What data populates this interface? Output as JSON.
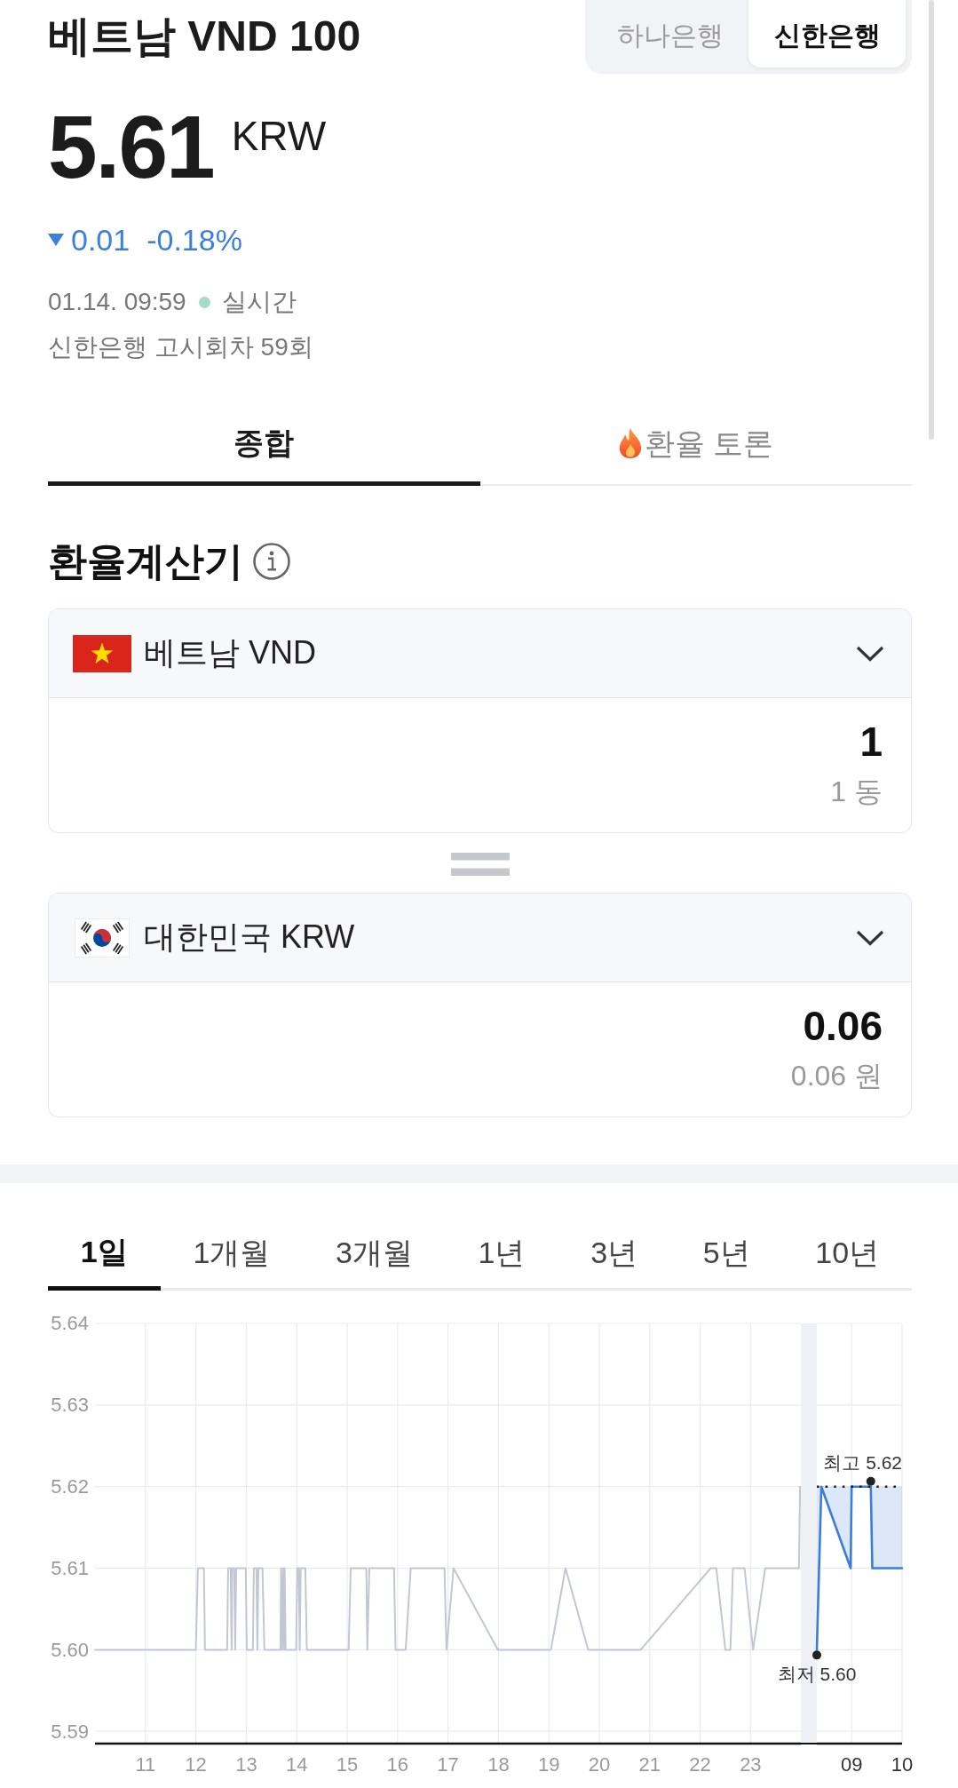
{
  "header": {
    "title": "베트남 VND 100",
    "banks": [
      {
        "label": "하나은행",
        "selected": false
      },
      {
        "label": "신한은행",
        "selected": true
      }
    ]
  },
  "quote": {
    "price": "5.61",
    "currency": "KRW",
    "change": {
      "falling": true,
      "amount": "0.01",
      "percent": "-0.18%"
    },
    "timestamp": "01.14. 09:59",
    "live": "실시간",
    "notice": "신한은행 고시회차 59회"
  },
  "tabs": [
    {
      "label": "종합",
      "selected": true,
      "kind": "plain"
    },
    {
      "label": "환율 토론",
      "selected": false,
      "kind": "fire"
    }
  ],
  "calculator": {
    "title": "환율계산기",
    "currencies": [
      {
        "kind": "vn",
        "name": "베트남 VND",
        "value": "1",
        "reading": "1 동"
      },
      {
        "kind": "kr",
        "name": "대한민국 KRW",
        "value": "0.06",
        "reading": "0.06 원"
      }
    ]
  },
  "chart": {
    "periods": [
      {
        "label": "1일",
        "selected": true
      },
      {
        "label": "1개월",
        "selected": false
      },
      {
        "label": "3개월",
        "selected": false
      },
      {
        "label": "1년",
        "selected": false
      },
      {
        "label": "3년",
        "selected": false
      },
      {
        "label": "5년",
        "selected": false
      },
      {
        "label": "10년",
        "selected": false
      }
    ],
    "sessions": [
      {
        "chart_data": {
          "type": "line",
          "grid": true,
          "x": [
            10,
            12.0,
            12.04,
            12.16,
            12.18,
            12.62,
            12.64,
            12.69,
            12.71,
            12.72,
            12.76,
            12.78,
            12.8,
            12.99,
            13.01,
            13.13,
            13.15,
            13.2,
            13.22,
            13.24,
            13.32,
            13.36,
            13.68,
            13.69,
            13.71,
            13.73,
            13.75,
            13.76,
            13.78,
            13.99,
            14.01,
            14.04,
            14.06,
            14.08,
            14.17,
            14.2,
            15.03,
            15.07,
            15.38,
            15.4,
            15.44,
            15.93,
            15.96,
            16.16,
            16.26,
            16.93,
            16.97,
            17.11,
            17.99,
            19.04,
            19.33,
            19.78,
            20.82,
            22.21,
            22.32,
            22.5,
            22.6,
            22.65,
            22.88,
            23.05,
            23.29,
            23.96,
            23.98
          ],
          "series": [
            {
              "color": "#c3c6d3",
              "values": [
                5.6,
                5.6,
                5.61,
                5.61,
                5.6,
                5.6,
                5.61,
                5.61,
                5.6,
                5.61,
                5.61,
                5.6,
                5.61,
                5.61,
                5.6,
                5.6,
                5.61,
                5.61,
                5.6,
                5.61,
                5.61,
                5.6,
                5.6,
                5.61,
                5.6,
                5.61,
                5.6,
                5.61,
                5.6,
                5.6,
                5.61,
                5.61,
                5.6,
                5.61,
                5.61,
                5.6,
                5.6,
                5.61,
                5.61,
                5.6,
                5.61,
                5.61,
                5.6,
                5.6,
                5.61,
                5.61,
                5.6,
                5.61,
                5.6,
                5.6,
                5.61,
                5.6,
                5.6,
                5.61,
                5.61,
                5.6,
                5.6,
                5.61,
                5.61,
                5.6,
                5.61,
                5.61,
                5.62
              ]
            }
          ],
          "xlim": [
            10,
            24
          ],
          "ylim": [
            5.5885,
            5.64
          ],
          "xticks": [
            11,
            12,
            13,
            14,
            15,
            16,
            17,
            18,
            19,
            20,
            21,
            22,
            23
          ],
          "yticks": [
            5.59,
            {
              "value": 5.6,
              "label": "5.60"
            },
            5.61,
            5.62,
            5.63,
            5.64
          ]
        }
      },
      {
        "chart_data": {
          "type": "line",
          "grid": true,
          "x": [
            8.31,
            8.4,
            8.98,
            9.0,
            9.38,
            9.41,
            10.0
          ],
          "series": [
            {
              "color": "#3b7dd8",
              "values": [
                5.6,
                5.62,
                5.61,
                5.62,
                5.62,
                5.61,
                5.61
              ]
            },
            {
              "color": "#222222",
              "line_style": "dotted",
              "values": [
                5.62,
                5.62,
                5.62,
                5.62,
                5.62,
                5.62,
                5.62
              ]
            }
          ],
          "xlim": [
            8.31,
            10
          ],
          "ylim": [
            5.5885,
            5.64
          ],
          "xticks": [
            {
              "value": 9,
              "label": "09"
            },
            10
          ],
          "annotations": [
            {
              "text": "최고 5.62",
              "x": 9.38,
              "y": 5.62
            },
            {
              "text": "최저 5.60",
              "x": 8.31,
              "y": 5.6
            }
          ]
        }
      }
    ]
  }
}
